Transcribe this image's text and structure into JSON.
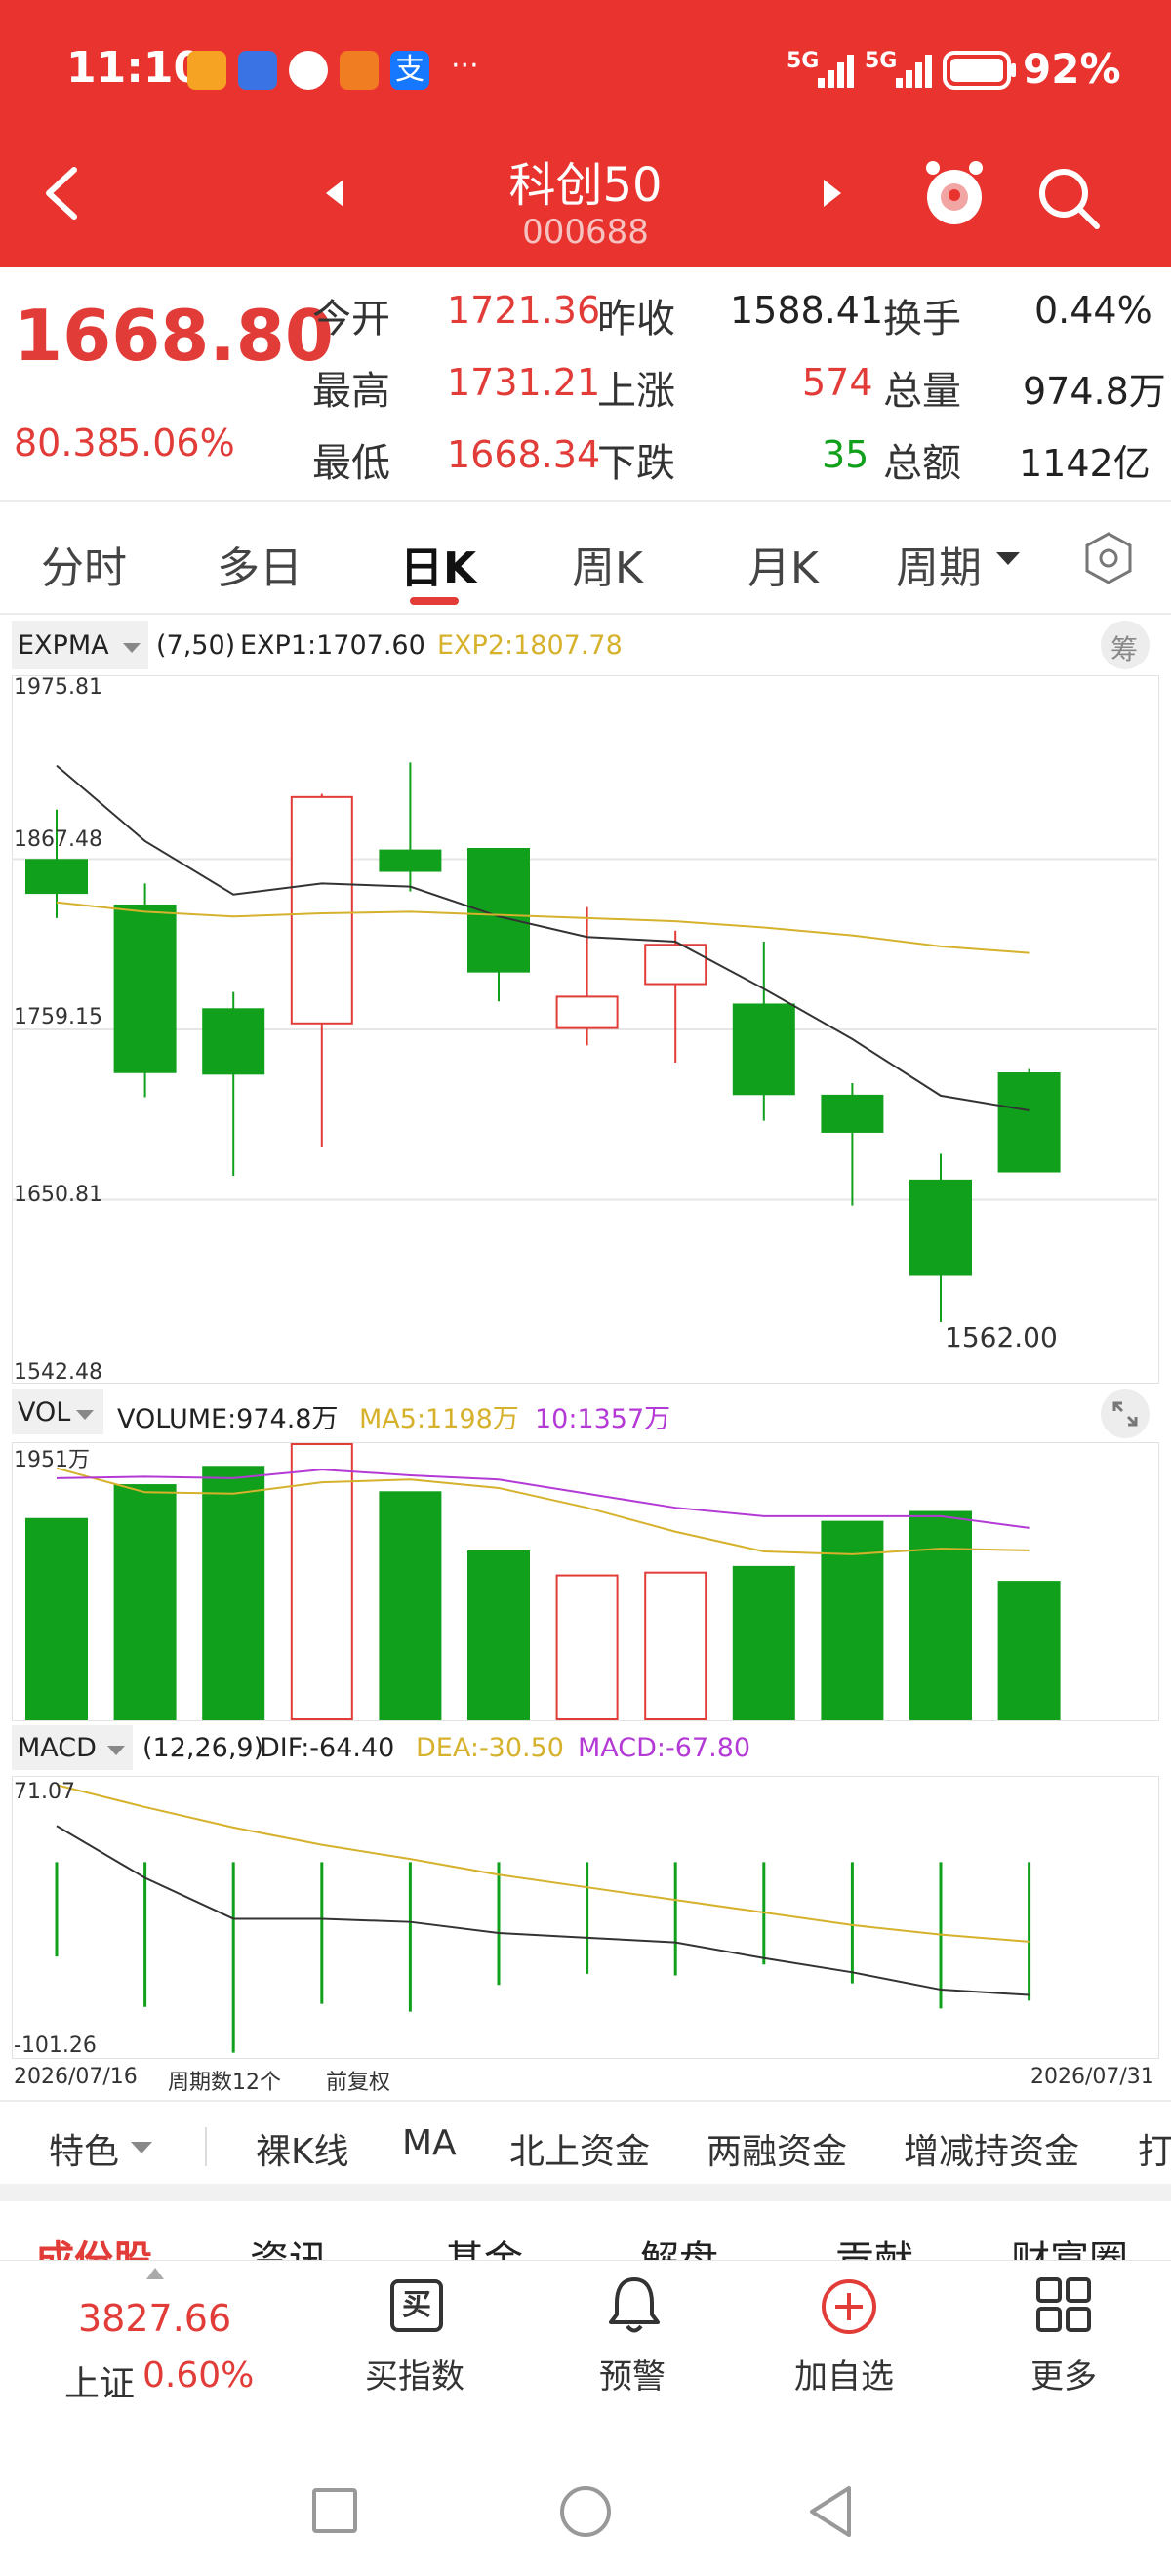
{
  "status": {
    "time": "11:10",
    "signal1": "5G",
    "signal2": "5G",
    "battery": "92%",
    "more": "···"
  },
  "nav": {
    "title": "科创50",
    "code": "000688"
  },
  "quote": {
    "price": "1668.80",
    "change": "80.38",
    "change_pct": "5.06%",
    "open_label": "今开",
    "open": "1721.36",
    "prev_close_label": "昨收",
    "prev_close": "1588.41",
    "turnover_label": "换手",
    "turnover": "0.44%",
    "high_label": "最高",
    "high": "1731.21",
    "up_label": "上涨",
    "up": "574",
    "volume_label": "总量",
    "volume": "974.8万",
    "low_label": "最低",
    "low": "1668.34",
    "down_label": "下跌",
    "down": "35",
    "amount_label": "总额",
    "amount": "1142亿"
  },
  "tabs": [
    "分时",
    "多日",
    "日K",
    "周K",
    "月K",
    "周期"
  ],
  "active_tab": "日K",
  "kline_panel": {
    "indicator": "EXPMA",
    "params": "(7,50)",
    "exp1": "EXP1:1707.60",
    "exp2": "EXP2:1807.78",
    "chip_label": "筹",
    "axis": [
      "1975.81",
      "1867.48",
      "1759.15",
      "1650.81",
      "1542.48"
    ],
    "low_marker": "1562.00"
  },
  "vol_panel": {
    "indicator": "VOL",
    "volume": "VOLUME:974.8万",
    "ma5": "MA5:1198万",
    "ma10": "10:1357万",
    "axis_top": "1951万"
  },
  "macd_panel": {
    "indicator": "MACD",
    "params": "(12,26,9)",
    "dif": "DIF:-64.40",
    "dea": "DEA:-30.50",
    "macd": "MACD:-67.80",
    "axis_top": "71.07",
    "axis_bottom": "-101.26"
  },
  "footer_row": {
    "start_date": "2026/07/16",
    "period_count": "周期数12个",
    "adjust": "前复权",
    "end_date": "2026/07/31"
  },
  "features": [
    "特色",
    "裸K线",
    "MA",
    "北上资金",
    "两融资金",
    "增减持资金",
    "打"
  ],
  "section_tabs": [
    "成份股",
    "资讯",
    "基金",
    "解盘",
    "贡献",
    "财富圈"
  ],
  "bottom_bar": {
    "index_value": "3827.66",
    "index_name": "上证",
    "index_pct": "0.60%",
    "buy": "买指数",
    "buy_icon_text": "买",
    "alert": "预警",
    "add": "加自选",
    "more": "更多"
  },
  "chart_data": {
    "type": "candlestick",
    "y_range": [
      1542.48,
      1975.81
    ],
    "candles": [
      {
        "open": 1867.0,
        "close": 1846.0,
        "high": 1899.0,
        "low": 1830.0
      },
      {
        "open": 1838.0,
        "close": 1732.0,
        "high": 1852.0,
        "low": 1716.0
      },
      {
        "open": 1772.0,
        "close": 1731.0,
        "high": 1783.0,
        "low": 1666.0
      },
      {
        "open": 1763.0,
        "close": 1907.0,
        "high": 1909.0,
        "low": 1684.0
      },
      {
        "open": 1873.0,
        "close": 1860.0,
        "high": 1929.0,
        "low": 1847.0
      },
      {
        "open": 1874.0,
        "close": 1796.0,
        "high": 1874.0,
        "low": 1777.0
      },
      {
        "open": 1760.0,
        "close": 1780.0,
        "high": 1837.0,
        "low": 1749.0
      },
      {
        "open": 1788.0,
        "close": 1813.0,
        "high": 1822.0,
        "low": 1738.0
      },
      {
        "open": 1775.0,
        "close": 1718.0,
        "high": 1815.0,
        "low": 1701.0
      },
      {
        "open": 1717.0,
        "close": 1694.0,
        "high": 1725.0,
        "low": 1647.0
      },
      {
        "open": 1663.0,
        "close": 1603.0,
        "high": 1680.0,
        "low": 1573.0
      },
      {
        "open": 1731.21,
        "close": 1668.8,
        "high": 1734.0,
        "low": 1668.34
      }
    ],
    "exp1": [
      1927,
      1879,
      1845,
      1852,
      1850,
      1831,
      1818,
      1815,
      1785,
      1753,
      1717,
      1707.6
    ],
    "exp2": [
      1840,
      1834,
      1831,
      1833,
      1834,
      1832,
      1830,
      1828,
      1824,
      1819,
      1812,
      1807.78
    ],
    "volume": {
      "max": 1951,
      "values": [
        1420,
        1660,
        1790,
        1951,
        1610,
        1190,
        1020,
        1040,
        1080,
        1400,
        1470,
        974.8
      ],
      "up": [
        false,
        false,
        false,
        true,
        false,
        false,
        true,
        true,
        false,
        false,
        false,
        false
      ],
      "ma5": [
        1780,
        1610,
        1600,
        1680,
        1700,
        1640,
        1500,
        1330,
        1190,
        1170,
        1210,
        1198
      ],
      "ma10": [
        1710,
        1720,
        1710,
        1770,
        1730,
        1700,
        1600,
        1500,
        1440,
        1440,
        1440,
        1357
      ]
    },
    "macd": {
      "range": [
        -101.26,
        71.07
      ],
      "dif": [
        43,
        10,
        -16,
        -16,
        -18,
        -25,
        -28,
        -31,
        -41,
        -50,
        -61,
        -64.4
      ],
      "dea": [
        69,
        55,
        42,
        31,
        22,
        12,
        4,
        -4,
        -12,
        -20,
        -26,
        -30.5
      ],
      "hist_top": [
        20,
        20,
        20,
        20,
        20,
        20,
        20,
        20,
        20,
        20,
        20,
        20
      ],
      "hist_bottom": [
        -40,
        -72,
        -101,
        -70,
        -75,
        -58,
        -51,
        -52,
        -45,
        -57,
        -73,
        -68
      ]
    }
  }
}
